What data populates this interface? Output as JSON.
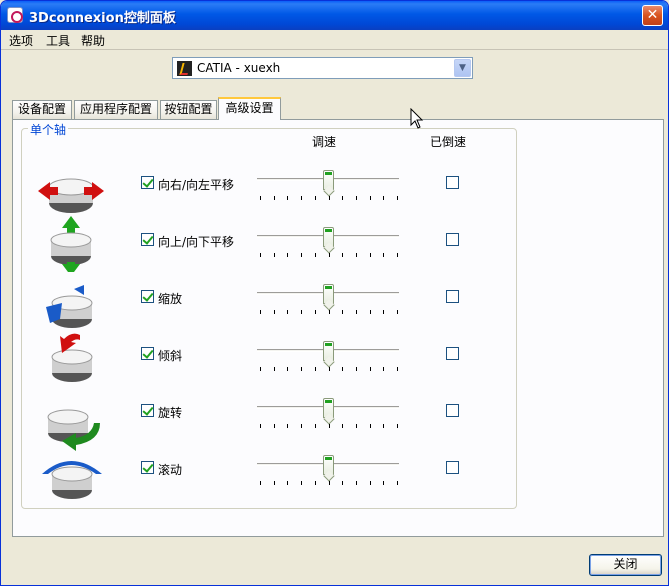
{
  "window": {
    "title": "3Dconnexion控制面板",
    "close_glyph": "✕"
  },
  "menu": [
    "选项",
    "工具",
    "帮助"
  ],
  "app_select": {
    "value": "CATIA - xuexh",
    "arrow": "▼"
  },
  "tabs": [
    {
      "label": "设备配置",
      "active": false
    },
    {
      "label": "应用程序配置",
      "active": false
    },
    {
      "label": "按钮配置",
      "active": false
    },
    {
      "label": "高级设置",
      "active": true
    }
  ],
  "group": {
    "legend": "单个轴",
    "col_speed": "调速",
    "col_dominant": "已倒速",
    "rows": [
      {
        "icon": "pan-left-right-icon",
        "label": "向右/向左平移",
        "enabled": true,
        "speed": 0.5,
        "dominant": false
      },
      {
        "icon": "pan-up-down-icon",
        "label": "向上/向下平移",
        "enabled": true,
        "speed": 0.5,
        "dominant": false
      },
      {
        "icon": "zoom-icon",
        "label": "缩放",
        "enabled": true,
        "speed": 0.5,
        "dominant": false
      },
      {
        "icon": "tilt-icon",
        "label": "倾斜",
        "enabled": true,
        "speed": 0.5,
        "dominant": false
      },
      {
        "icon": "spin-icon",
        "label": "旋转",
        "enabled": true,
        "speed": 0.5,
        "dominant": false
      },
      {
        "icon": "roll-icon",
        "label": "滚动",
        "enabled": true,
        "speed": 0.5,
        "dominant": false
      }
    ]
  },
  "ok_button": "关闭",
  "colors": {
    "accent": "#0046d5",
    "check": "#21a121",
    "red_arrow": "#d01010",
    "green_arrow": "#1fa51f",
    "blue_arrow": "#1a5bc8"
  }
}
